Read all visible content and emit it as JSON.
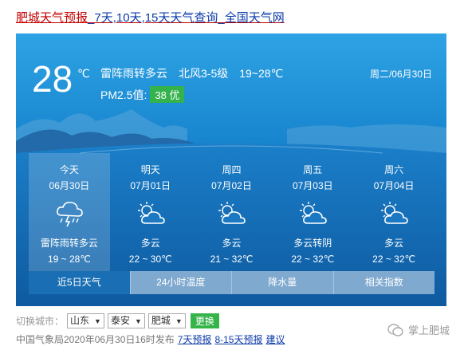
{
  "title": {
    "part_red": "肥城天气预报",
    "part_link": "_7天,10天,15天天气查询_全国天气网"
  },
  "current": {
    "temp": "28",
    "unit": "℃",
    "condition": "雷阵雨转多云",
    "wind": "北风3-5级",
    "range": "19~28℃",
    "pm_label": "PM2.5值:",
    "pm_value": "38 优",
    "date": "周二/06月30日"
  },
  "days": [
    {
      "name": "今天",
      "date": "06月30日",
      "icon": "thunderstorm-icon",
      "cond": "雷阵雨转多云",
      "range": "19 ~ 28℃"
    },
    {
      "name": "明天",
      "date": "07月01日",
      "icon": "partly-cloudy-icon",
      "cond": "多云",
      "range": "22 ~ 30℃"
    },
    {
      "name": "周四",
      "date": "07月02日",
      "icon": "partly-cloudy-icon",
      "cond": "多云",
      "range": "21 ~ 32℃"
    },
    {
      "name": "周五",
      "date": "07月03日",
      "icon": "partly-cloudy-icon",
      "cond": "多云转阴",
      "range": "22 ~ 32℃"
    },
    {
      "name": "周六",
      "date": "07月04日",
      "icon": "partly-cloudy-icon",
      "cond": "多云",
      "range": "22 ~ 32℃"
    }
  ],
  "tabs": [
    "近5日天气",
    "24小时温度",
    "降水量",
    "相关指数"
  ],
  "city_switch": {
    "label": "切换城市：",
    "province": "山东",
    "city": "泰安",
    "county": "肥城",
    "button": "更换"
  },
  "footer": {
    "source": "中国气象局2020年06月30日16时发布",
    "link1": "7天预报",
    "link2": "8-15天预报",
    "link3": "建议"
  },
  "watermark": "掌上肥城",
  "colors": {
    "pm_good": "#34b24c",
    "title_red": "#c30000",
    "link_blue": "#0b3aa8"
  }
}
